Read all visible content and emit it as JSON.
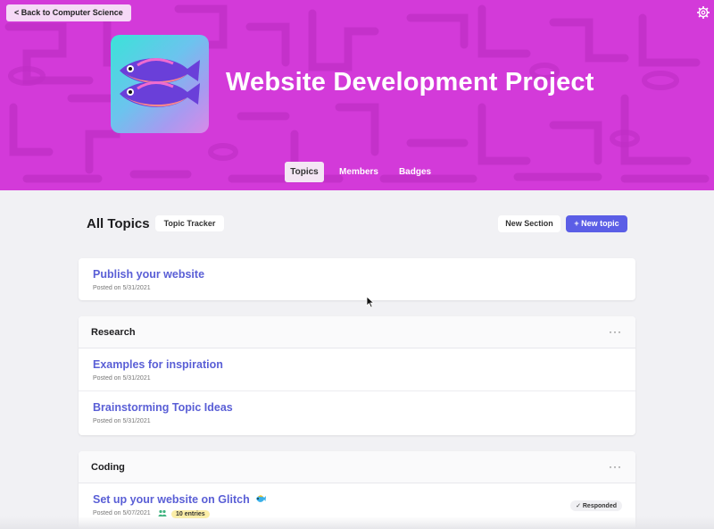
{
  "header": {
    "back_label": "< Back to Computer Science",
    "title": "Website Development Project",
    "settings_icon": "gear-icon",
    "brand_color": "#d33ad9",
    "tabs": [
      {
        "label": "Topics",
        "active": true
      },
      {
        "label": "Members",
        "active": false
      },
      {
        "label": "Badges",
        "active": false
      }
    ]
  },
  "toolbar": {
    "heading": "All Topics",
    "tracker_label": "Topic Tracker",
    "new_section_label": "New Section",
    "new_topic_label": "+ New topic"
  },
  "pinned": {
    "title": "Publish your website",
    "meta": "Posted on 5/31/2021"
  },
  "sections": [
    {
      "name": "Research",
      "more": "···",
      "topics": [
        {
          "title": "Examples for inspiration",
          "meta": "Posted on 5/31/2021"
        },
        {
          "title": "Brainstorming Topic Ideas",
          "meta": "Posted on 5/31/2021"
        }
      ]
    },
    {
      "name": "Coding",
      "more": "···",
      "topics": [
        {
          "title": "Set up your website on Glitch",
          "meta": "Posted on 5/07/2021",
          "entries": "10 entries",
          "status": "Responded"
        }
      ]
    }
  ]
}
